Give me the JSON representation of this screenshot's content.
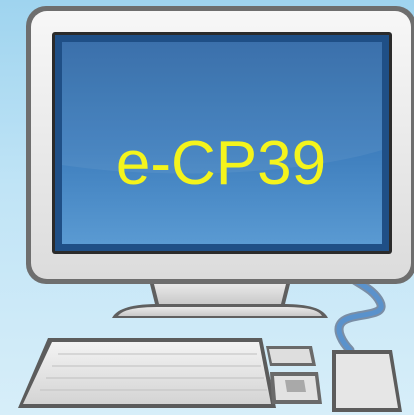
{
  "screen_text": "e-CP39",
  "icon": "desktop-computer-icon",
  "colors": {
    "background": "#b9e1f5",
    "screen": "#3b79b6",
    "screen_text": "#f4f41c",
    "monitor_frame": "#efefef",
    "cable": "#4f86c2"
  }
}
